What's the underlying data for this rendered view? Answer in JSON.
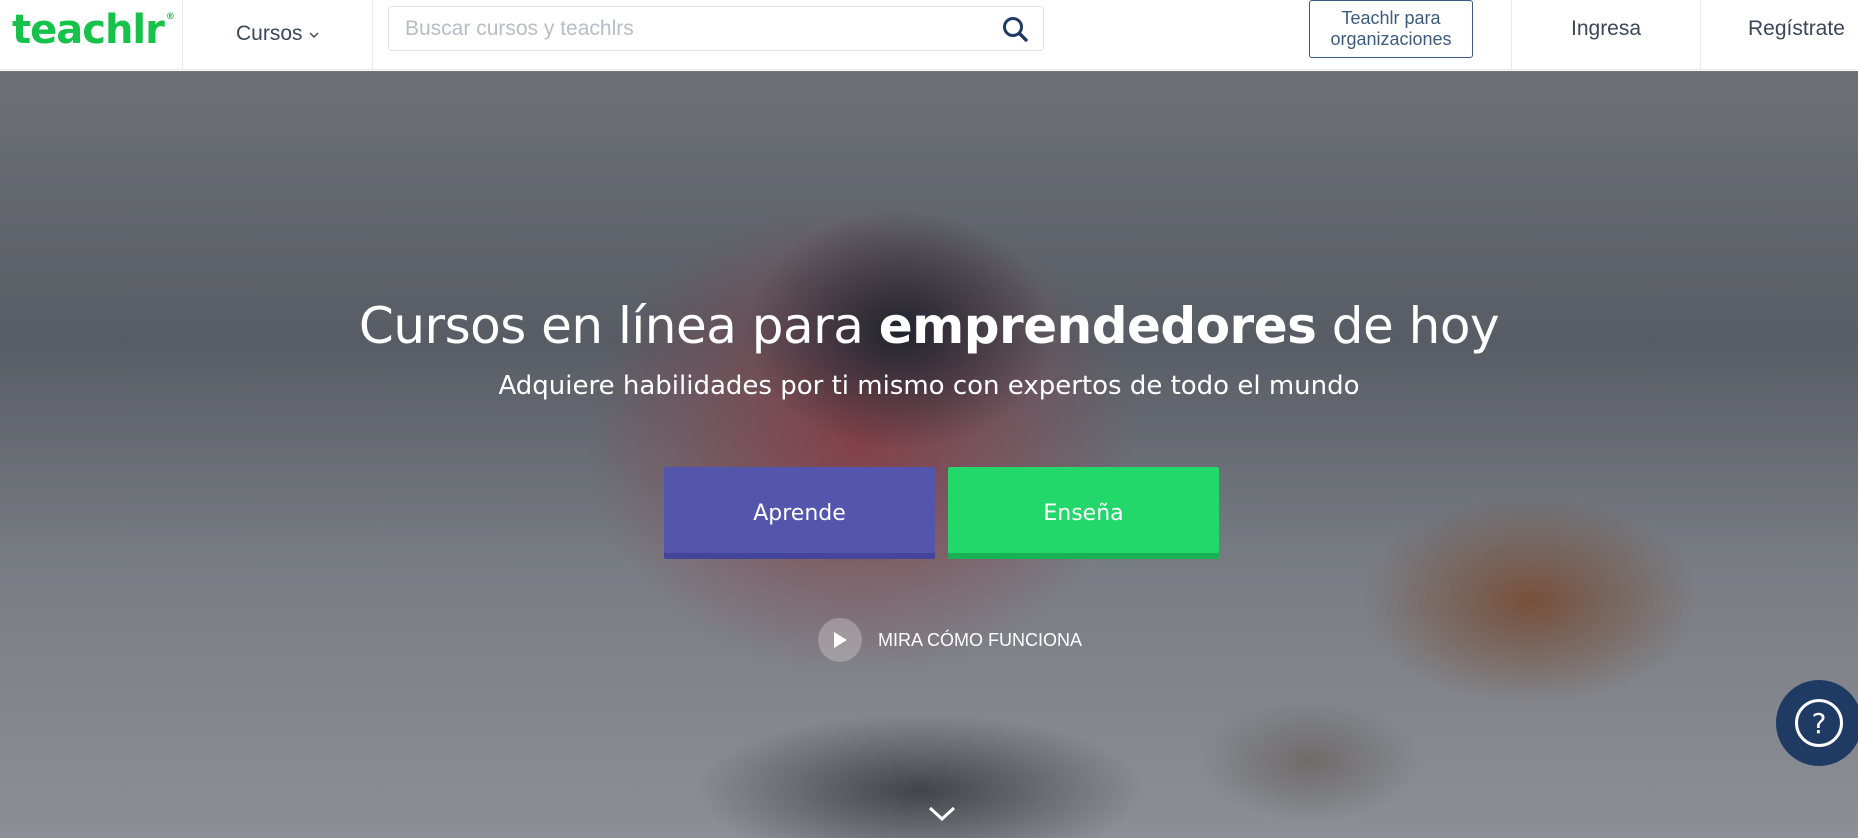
{
  "header": {
    "logo_text": "teachlr",
    "logo_mark": "®",
    "courses_label": "Cursos",
    "search_placeholder": "Buscar cursos y teachlrs",
    "search_icon": "search-icon",
    "org_button_line1": "Teachlr para",
    "org_button_line2": "organizaciones",
    "login_label": "Ingresa",
    "register_label": "Regístrate"
  },
  "hero": {
    "title_part1": "Cursos en línea para ",
    "title_bold": "emprendedores",
    "title_part2": " de hoy",
    "subtitle": "Adquiere habilidades por ti mismo con expertos de todo el mundo",
    "learn_button": "Aprende",
    "teach_button": "Enseña",
    "how_it_works": "MIRA CÓMO FUNCIONA"
  },
  "colors": {
    "brand_green": "#17c24a",
    "learn_purple": "#5455ad",
    "teach_green": "#22d86a",
    "org_blue": "#3d5a80",
    "help_navy": "#1f3a63"
  },
  "icons": [
    "chevron-down-icon",
    "search-icon",
    "play-icon",
    "scroll-down-chevron-icon",
    "help-question-icon"
  ]
}
